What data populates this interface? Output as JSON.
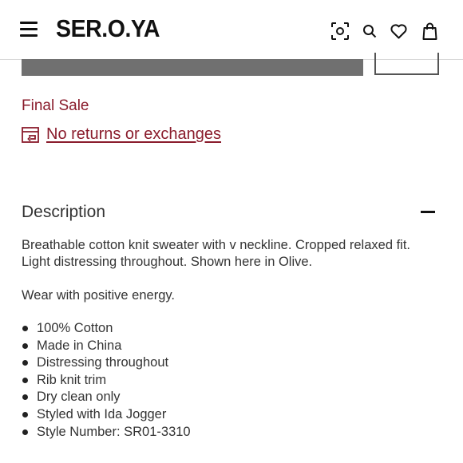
{
  "header": {
    "brand": "SER.O.YA",
    "icons": [
      "menu-icon",
      "visual-search-icon",
      "search-icon",
      "heart-icon",
      "shopping-bag-icon"
    ]
  },
  "sale": {
    "label": "Final Sale",
    "returns_text": "No returns or exchanges",
    "accent_color": "#8a1c2c"
  },
  "description": {
    "title": "Description",
    "paragraph1": "Breathable cotton knit sweater with v neckline. Cropped relaxed fit. Light distressing throughout. Shown here in Olive.",
    "paragraph2": "Wear with positive energy.",
    "bullets": [
      "100% Cotton",
      "Made in China",
      "Distressing throughout",
      "Rib knit trim",
      "Dry clean only",
      "Styled with Ida Jogger",
      "Style Number: SR01-3310"
    ]
  }
}
